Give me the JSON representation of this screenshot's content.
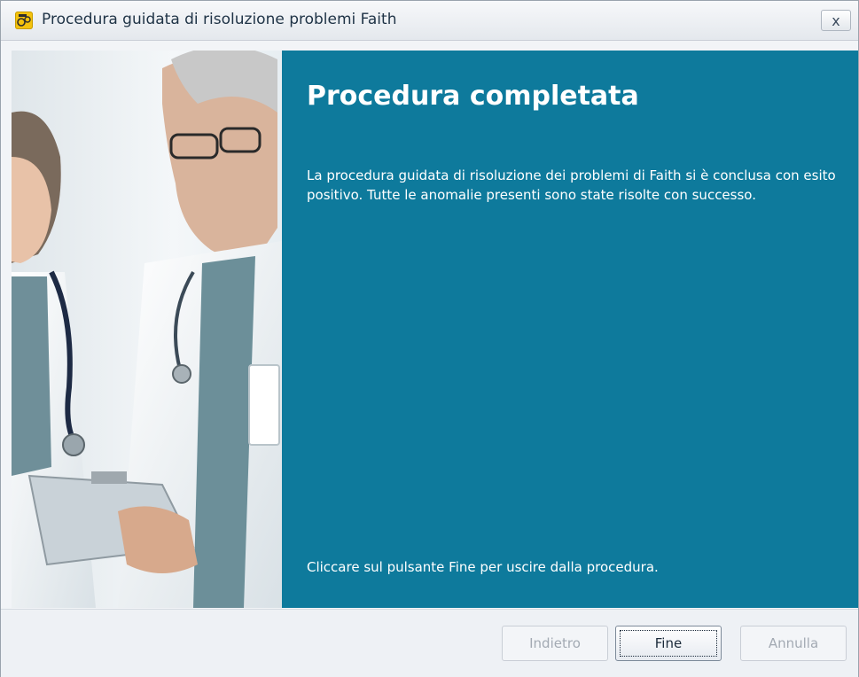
{
  "window": {
    "title": "Procedura guidata di risoluzione problemi Faith",
    "close_label": "x",
    "app_icon": "faith-app-icon"
  },
  "side_panel": {
    "image": "doctors-photo"
  },
  "content": {
    "heading": "Procedura completata",
    "description": "La procedura guidata di risoluzione dei problemi di Faith si è conclusa con esito positivo. Tutte le anomalie presenti sono state risolte con successo.",
    "footer_note": "Cliccare sul pulsante Fine per uscire dalla procedura.",
    "panel_color": "#0e7a9c"
  },
  "buttons": {
    "back": {
      "label": "Indietro",
      "enabled": false
    },
    "finish": {
      "label": "Fine",
      "enabled": true
    },
    "cancel": {
      "label": "Annulla",
      "enabled": false
    }
  }
}
